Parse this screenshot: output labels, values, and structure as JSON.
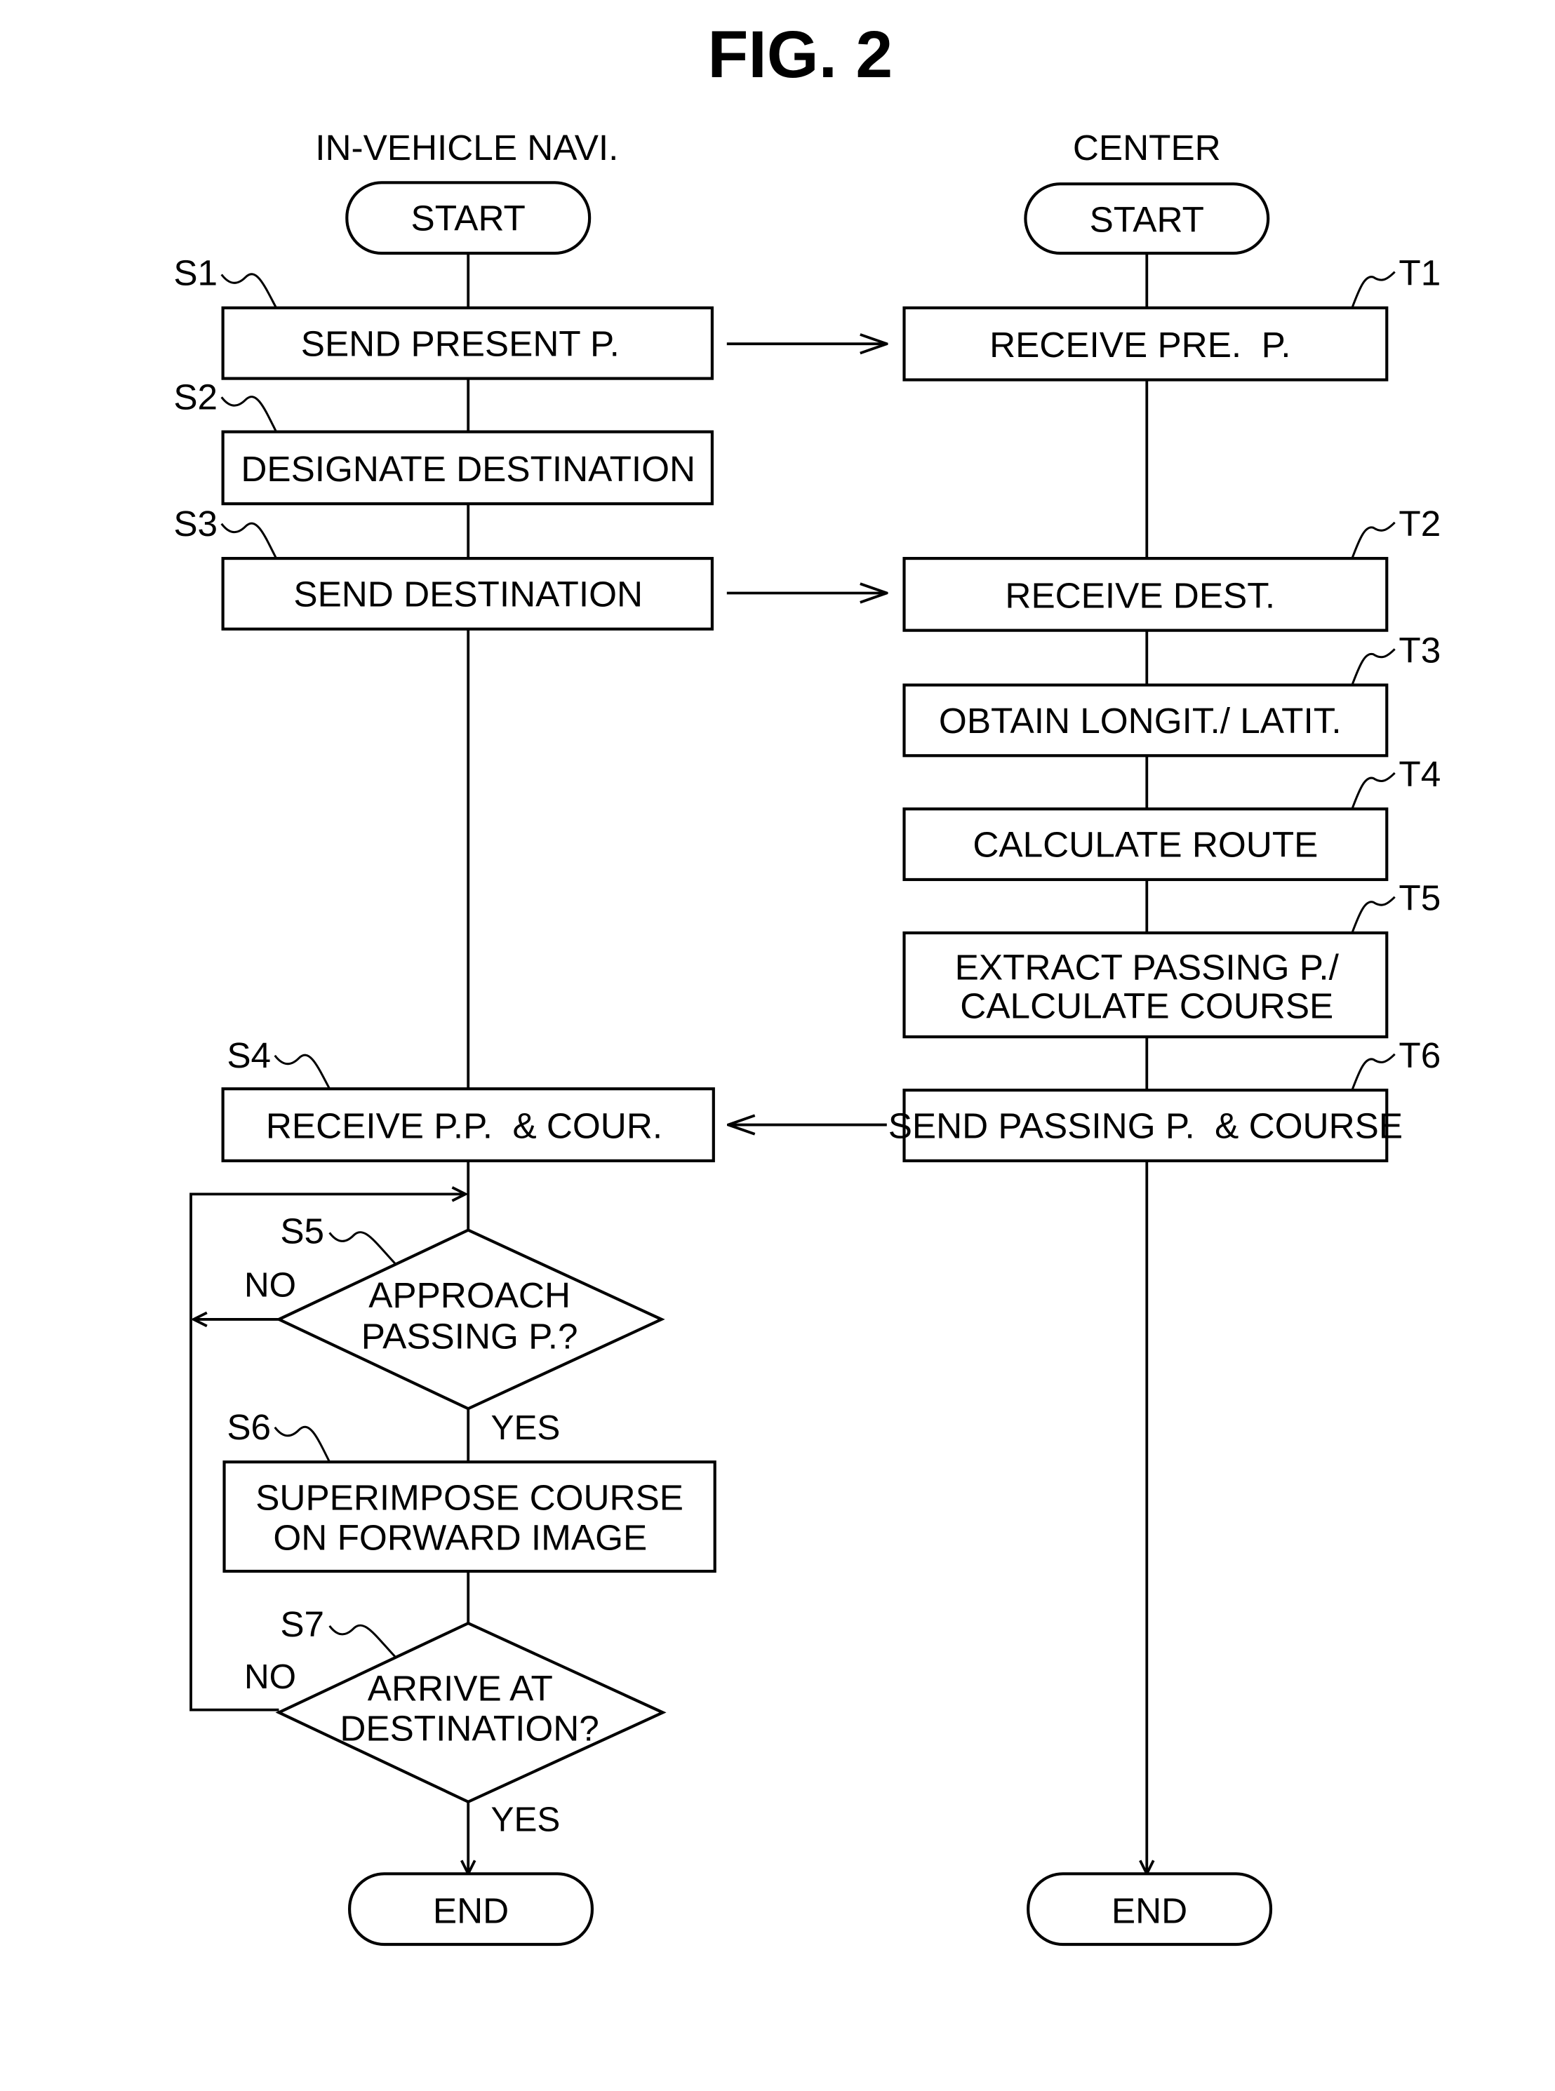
{
  "figure": {
    "title": "FIG. 2"
  },
  "lanes": {
    "left": "IN-VEHICLE NAVI.",
    "right": "CENTER"
  },
  "terminals": {
    "left_start": "START",
    "right_start": "START",
    "left_end": "END",
    "right_end": "END"
  },
  "steps": {
    "S1": {
      "ref": "S1",
      "lines": [
        "SEND PRESENT P."
      ]
    },
    "S2": {
      "ref": "S2",
      "lines": [
        "DESIGNATE DESTINATION"
      ]
    },
    "S3": {
      "ref": "S3",
      "lines": [
        "SEND DESTINATION"
      ]
    },
    "S4": {
      "ref": "S4",
      "lines": [
        "RECEIVE P.P.  & COUR."
      ]
    },
    "S5": {
      "ref": "S5",
      "lines": [
        "APPROACH",
        "PASSING P.?"
      ],
      "no": "NO",
      "yes": "YES"
    },
    "S6": {
      "ref": "S6",
      "lines": [
        "SUPERIMPOSE COURSE",
        "ON FORWARD IMAGE"
      ]
    },
    "S7": {
      "ref": "S7",
      "lines": [
        "ARRIVE AT",
        "DESTINATION?"
      ],
      "no": "NO",
      "yes": "YES"
    },
    "T1": {
      "ref": "T1",
      "lines": [
        "RECEIVE PRE.  P."
      ]
    },
    "T2": {
      "ref": "T2",
      "lines": [
        "RECEIVE DEST."
      ]
    },
    "T3": {
      "ref": "T3",
      "lines": [
        "OBTAIN LONGIT./ LATIT."
      ]
    },
    "T4": {
      "ref": "T4",
      "lines": [
        "CALCULATE ROUTE"
      ]
    },
    "T5": {
      "ref": "T5",
      "lines": [
        "EXTRACT PASSING P./",
        "CALCULATE COURSE"
      ]
    },
    "T6": {
      "ref": "T6",
      "lines": [
        "SEND PASSING P.  & COURSE"
      ]
    }
  }
}
